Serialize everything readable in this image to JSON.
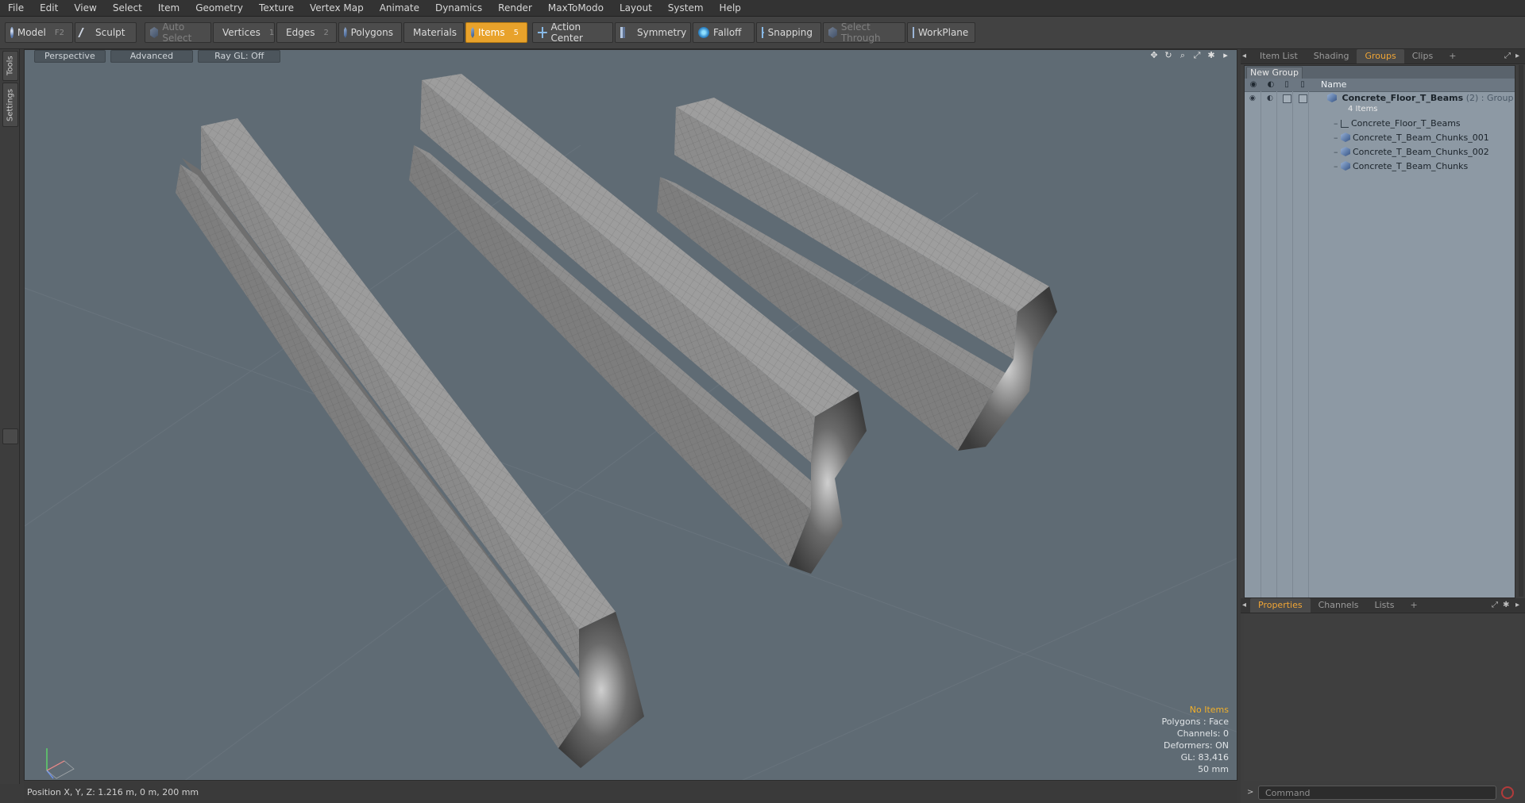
{
  "menu": [
    "File",
    "Edit",
    "View",
    "Select",
    "Item",
    "Geometry",
    "Texture",
    "Vertex Map",
    "Animate",
    "Dynamics",
    "Render",
    "MaxToModo",
    "Layout",
    "System",
    "Help"
  ],
  "toolbar": {
    "model": "Model",
    "model_key": "F2",
    "sculpt": "Sculpt",
    "auto_select": "Auto Select",
    "vertices": "Vertices",
    "vertices_key": "1",
    "edges": "Edges",
    "edges_key": "2",
    "polygons": "Polygons",
    "materials": "Materials",
    "items": "Items",
    "items_key": "5",
    "action_center": "Action Center",
    "symmetry": "Symmetry",
    "falloff": "Falloff",
    "snapping": "Snapping",
    "select_through": "Select Through",
    "workplane": "WorkPlane",
    "active_color": "#e8a22b"
  },
  "left_tabs": {
    "tools": "Tools",
    "settings": "Settings"
  },
  "viewport": {
    "view": "Perspective",
    "mode": "Advanced",
    "raygl": "Ray GL: Off",
    "background_color": "#5f6b74"
  },
  "hud": {
    "selection": "No Items",
    "polygons": "Polygons : Face",
    "channels": "Channels: 0",
    "deformers": "Deformers: ON",
    "gl": "GL: 83,416",
    "scale": "50 mm"
  },
  "status": {
    "position": "Position X, Y, Z:   1.216 m, 0 m, 200 mm"
  },
  "right_panel": {
    "tabs": [
      "Item List",
      "Shading",
      "Groups",
      "Clips",
      "+"
    ],
    "active_tab": "Groups",
    "new_group": "New Group",
    "column_name": "Name",
    "group": {
      "name": "Concrete_Floor_T_Beams",
      "count": "(2)",
      "type": ": Group",
      "items_label": "4 Items"
    },
    "items": [
      "Concrete_Floor_T_Beams",
      "Concrete_T_Beam_Chunks_001",
      "Concrete_T_Beam_Chunks_002",
      "Concrete_T_Beam_Chunks"
    ],
    "bottom_tabs": [
      "Properties",
      "Channels",
      "Lists",
      "+"
    ],
    "active_bottom_tab": "Properties",
    "command_placeholder": "Command"
  }
}
